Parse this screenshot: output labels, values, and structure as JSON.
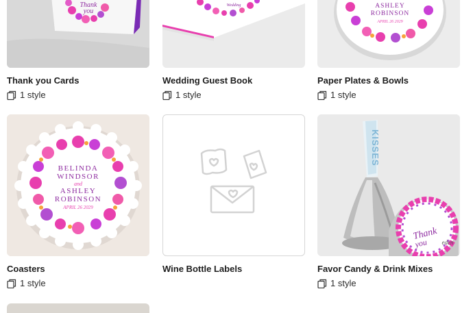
{
  "products": [
    {
      "title": "Thank you Cards",
      "styles": "1 style",
      "card_text": [
        "Thank",
        "you"
      ]
    },
    {
      "title": "Wedding Guest Book",
      "styles": "1 style",
      "card_text": [
        "Wedding"
      ]
    },
    {
      "title": "Paper Plates & Bowls",
      "styles": "1 style",
      "card_text": [
        "ASHLEY",
        "ROBINSON",
        "APRIL 26 2029"
      ]
    },
    {
      "title": "Coasters",
      "styles": "1 style",
      "card_text": [
        "BELINDA",
        "WINDSOR",
        "and",
        "ASHLEY",
        "ROBINSON",
        "APRIL 26 2029"
      ]
    },
    {
      "title": "Wine Bottle Labels",
      "styles": "",
      "card_text": []
    },
    {
      "title": "Favor Candy & Drink Mixes",
      "styles": "1 style",
      "card_text": [
        "KISSES",
        "Thank",
        "you",
        "eden"
      ]
    }
  ],
  "icons": {
    "styles": "stacked-cards-icon",
    "placeholder": "stationery-placeholder-icon"
  },
  "colors": {
    "floral_pink": "#e83fae",
    "floral_purple": "#a24bc9",
    "text_purple": "#8e2ca0"
  }
}
